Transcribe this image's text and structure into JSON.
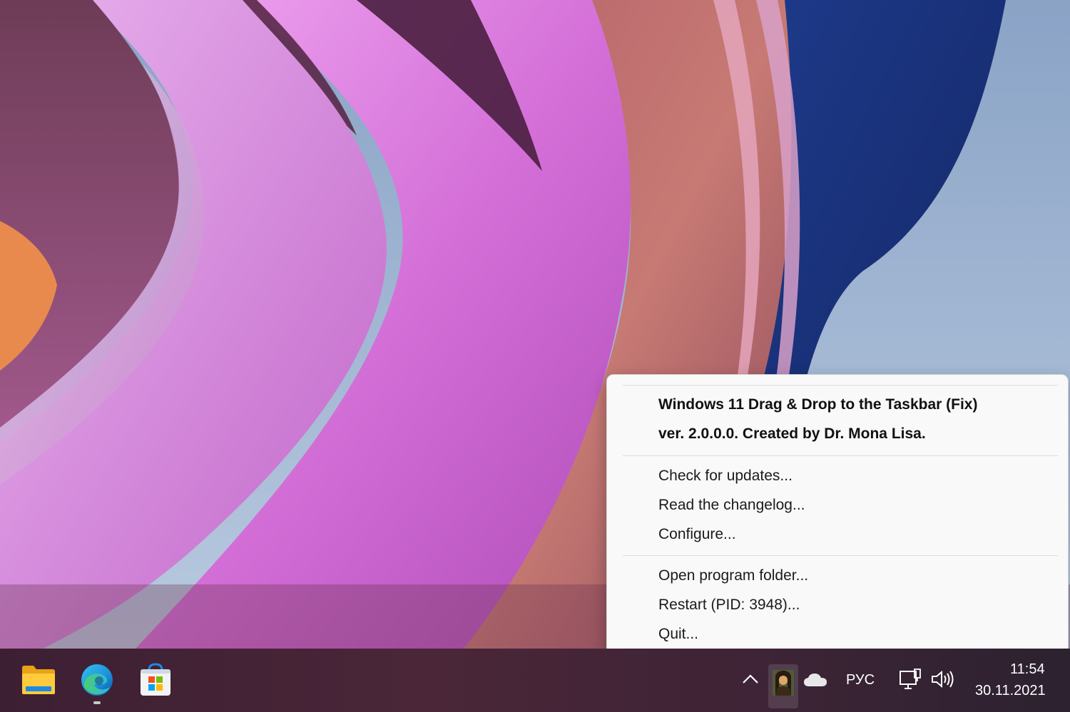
{
  "menu": {
    "header_line1": "Windows 11 Drag & Drop to the Taskbar (Fix)",
    "header_line2": "ver. 2.0.0.0. Created by Dr. Mona Lisa.",
    "items": [
      {
        "label": "Check for updates..."
      },
      {
        "label": "Read the changelog..."
      },
      {
        "label": "Configure..."
      },
      {
        "label": "Open program folder..."
      },
      {
        "label": "Restart (PID: 3948)..."
      },
      {
        "label": "Quit..."
      }
    ]
  },
  "taskbar": {
    "apps": [
      {
        "icon": "file-explorer-icon"
      },
      {
        "icon": "edge-browser-icon",
        "active": true
      },
      {
        "icon": "microsoft-store-icon"
      }
    ],
    "tray": {
      "chevron_icon": "chevron-up-icon",
      "app_icon": "mona-lisa-icon",
      "cloud_icon": "onedrive-icon",
      "language": "РУС",
      "network_icon": "network-icon",
      "volume_icon": "volume-icon",
      "time": "11:54",
      "date": "30.11.2021"
    }
  },
  "colors": {
    "menu_background": "#f9f9f9",
    "menu_text": "#1b1b1b",
    "taskbar_background": "#4a2638"
  }
}
